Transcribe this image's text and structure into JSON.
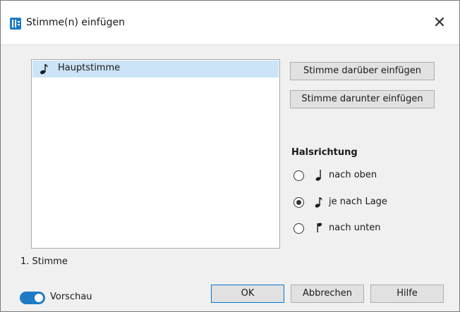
{
  "window": {
    "title": "Stimme(n) einfügen",
    "close_glyph": "✕",
    "app_icon": "notation-app-icon"
  },
  "voice_list": {
    "items": [
      {
        "label": "Hauptstimme",
        "icon": "quarter-note-icon",
        "selected": true
      }
    ]
  },
  "buttons": {
    "insert_above": "Stimme darüber einfügen",
    "insert_below": "Stimme darunter einfügen",
    "ok": "OK",
    "cancel": "Abbrechen",
    "help": "Hilfe"
  },
  "stem_direction": {
    "title": "Halsrichtung",
    "options": [
      {
        "label": "nach oben",
        "icon": "stem-up-note-icon",
        "selected": false
      },
      {
        "label": "je nach Lage",
        "icon": "stem-auto-note-icon",
        "selected": true
      },
      {
        "label": "nach unten",
        "icon": "stem-down-note-icon",
        "selected": false
      }
    ]
  },
  "status": {
    "voice_count": "1. Stimme"
  },
  "preview": {
    "label": "Vorschau",
    "enabled": true
  },
  "colors": {
    "accent": "#1e7bc4",
    "selection": "#cce4f7"
  }
}
